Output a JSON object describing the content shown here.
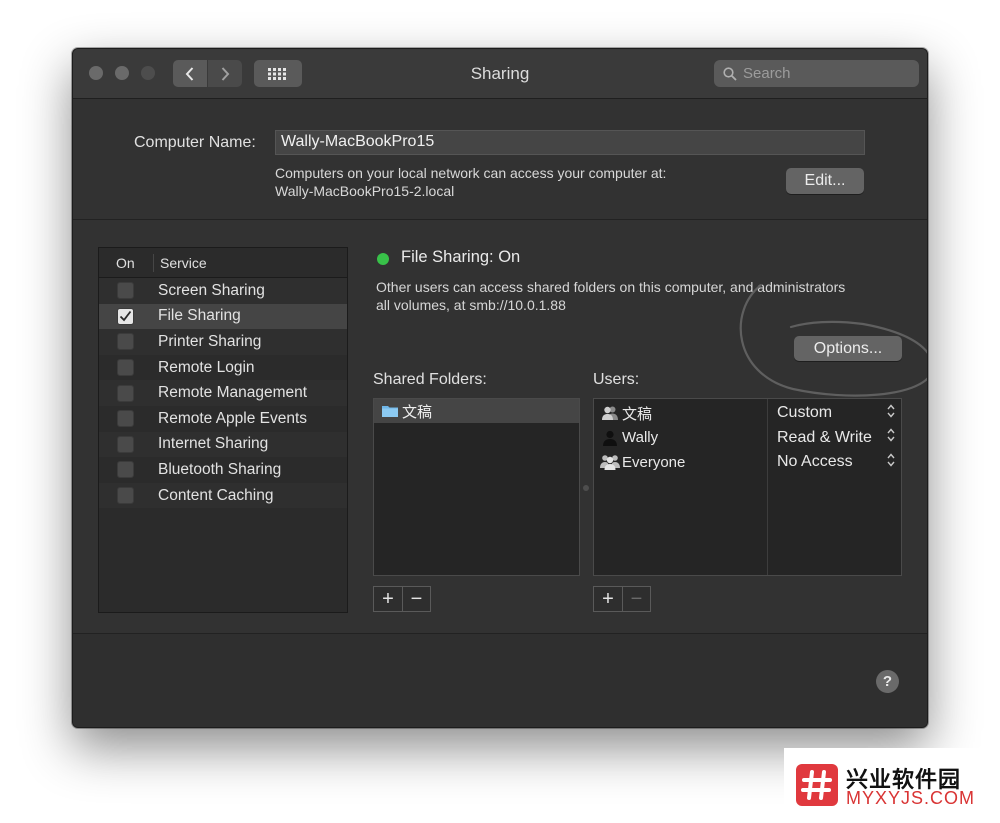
{
  "window": {
    "title": "Sharing"
  },
  "search": {
    "placeholder": "Search"
  },
  "computer_name": {
    "label": "Computer Name:",
    "value": "Wally-MacBookPro15",
    "network_line1": "Computers on your local network can access your computer at:",
    "network_line2": "Wally-MacBookPro15-2.local",
    "edit_label": "Edit..."
  },
  "services": {
    "header_on": "On",
    "header_service": "Service",
    "items": [
      {
        "label": "Screen Sharing",
        "checked": false
      },
      {
        "label": "File Sharing",
        "checked": true
      },
      {
        "label": "Printer Sharing",
        "checked": false
      },
      {
        "label": "Remote Login",
        "checked": false
      },
      {
        "label": "Remote Management",
        "checked": false
      },
      {
        "label": "Remote Apple Events",
        "checked": false
      },
      {
        "label": "Internet Sharing",
        "checked": false
      },
      {
        "label": "Bluetooth Sharing",
        "checked": false
      },
      {
        "label": "Content Caching",
        "checked": false
      }
    ]
  },
  "file_sharing": {
    "status": "File Sharing: On",
    "status_color": "#38c149",
    "desc_line1": "Other users can access shared folders on this computer, and administrators",
    "desc_line2": "all volumes, at smb://10.0.1.88",
    "options_label": "Options..."
  },
  "shared_folders": {
    "label": "Shared Folders:",
    "items": [
      "文稿"
    ]
  },
  "users": {
    "label": "Users:",
    "items": [
      {
        "name": "文稿",
        "icon": "user-group-icon",
        "permission": "Custom"
      },
      {
        "name": "Wally",
        "icon": "user-icon",
        "permission": "Read & Write"
      },
      {
        "name": "Everyone",
        "icon": "everyone-icon",
        "permission": "No Access"
      }
    ]
  },
  "controls": {
    "add": "+",
    "remove": "−",
    "help": "?"
  },
  "watermark": {
    "cn": "兴业软件园",
    "en": "MYXYJS.COM"
  }
}
